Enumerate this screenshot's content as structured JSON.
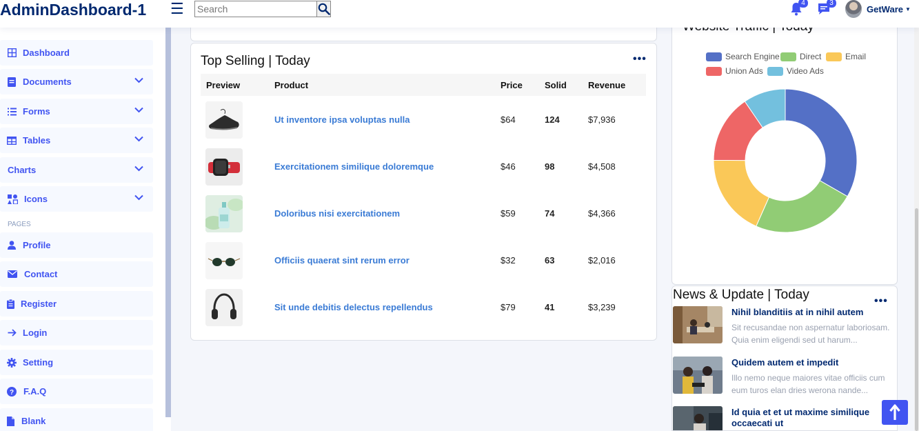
{
  "header": {
    "logo": "AdminDashboard-1",
    "search_placeholder": "Search",
    "notifications_count": "4",
    "messages_count": "3",
    "profile_name": "GetWare"
  },
  "sidebar": {
    "items": [
      {
        "label": "Dashboard",
        "icon": "grid-icon"
      },
      {
        "label": "Documents",
        "icon": "document-icon"
      },
      {
        "label": "Forms",
        "icon": "list-icon"
      },
      {
        "label": "Tables",
        "icon": "table-icon"
      },
      {
        "label": "Charts",
        "icon": "chart-icon"
      },
      {
        "label": "Icons",
        "icon": "icons-icon"
      }
    ],
    "pages_heading": "PAGES",
    "pages": [
      {
        "label": "Profile",
        "icon": "person-icon"
      },
      {
        "label": "Contact",
        "icon": "envelope-icon"
      },
      {
        "label": "Register",
        "icon": "clipboard-icon"
      },
      {
        "label": "Login",
        "icon": "arrow-right-icon"
      },
      {
        "label": "Setting",
        "icon": "gear-icon"
      },
      {
        "label": "F.A.Q",
        "icon": "question-icon"
      },
      {
        "label": "Blank",
        "icon": "file-icon"
      }
    ]
  },
  "top_selling": {
    "title": "Top Selling | Today",
    "columns": [
      "Preview",
      "Product",
      "Price",
      "Solid",
      "Revenue"
    ],
    "rows": [
      {
        "product": "Ut inventore ipsa voluptas nulla",
        "price": "$64",
        "sold": "124",
        "revenue": "$7,936",
        "thumb": "shoe"
      },
      {
        "product": "Exercitationem similique doloremque",
        "price": "$46",
        "sold": "98",
        "revenue": "$4,508",
        "thumb": "watch"
      },
      {
        "product": "Doloribus nisi exercitationem",
        "price": "$59",
        "sold": "74",
        "revenue": "$4,366",
        "thumb": "bottle"
      },
      {
        "product": "Officiis quaerat sint rerum error",
        "price": "$32",
        "sold": "63",
        "revenue": "$2,016",
        "thumb": "sunglasses"
      },
      {
        "product": "Sit unde debitis delectus repellendus",
        "price": "$79",
        "sold": "41",
        "revenue": "$3,239",
        "thumb": "headphones"
      }
    ]
  },
  "traffic": {
    "title": "Website Traffic | Today",
    "legend": [
      {
        "name": "Search Engine",
        "color": "#5470c6"
      },
      {
        "name": "Direct",
        "color": "#91cc75"
      },
      {
        "name": "Email",
        "color": "#fac858"
      },
      {
        "name": "Union Ads",
        "color": "#ee6666"
      },
      {
        "name": "Video Ads",
        "color": "#73c0de"
      }
    ]
  },
  "chart_data": {
    "type": "pie",
    "title": "",
    "categories": [
      "Search Engine",
      "Direct",
      "Email",
      "Union Ads",
      "Video Ads"
    ],
    "values": [
      1048,
      735,
      580,
      484,
      300
    ],
    "colors": [
      "#5470c6",
      "#91cc75",
      "#fac858",
      "#ee6666",
      "#73c0de"
    ],
    "legend_position": "top"
  },
  "news": {
    "title": "News & Update | Today",
    "items": [
      {
        "headline": "Nihil blanditiis at in nihil autem",
        "text": "Sit recusandae non aspernatur laboriosam. Quia enim eligendi sed ut harum..."
      },
      {
        "headline": "Quidem autem et impedit",
        "text": "Illo nemo neque maiores vitae officiis cum eum turos elan dries werona nande..."
      },
      {
        "headline": "Id quia et et ut maxime similique occaecati ut",
        "text": ""
      }
    ]
  }
}
